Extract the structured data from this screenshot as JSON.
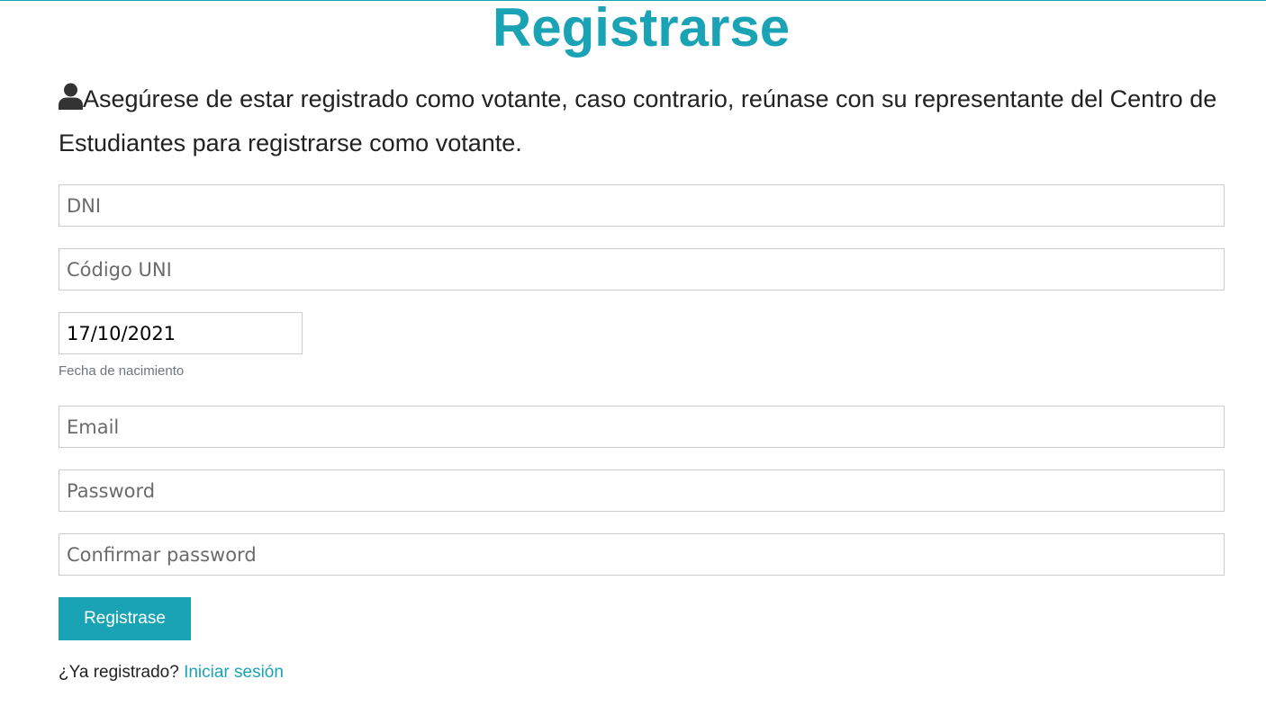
{
  "page": {
    "title": "Registrarse"
  },
  "notice": {
    "icon": "user-icon",
    "text": "Asegúrese de estar registrado como votante, caso contrario, reúnase con su representante del Centro de Estudiantes para registrarse como votante."
  },
  "form": {
    "dni": {
      "placeholder": "DNI",
      "value": ""
    },
    "codigo": {
      "placeholder": "Código UNI",
      "value": ""
    },
    "birthdate": {
      "value": "17/10/2021",
      "help": "Fecha de nacimiento"
    },
    "email": {
      "placeholder": "Email",
      "value": ""
    },
    "password": {
      "placeholder": "Password",
      "value": ""
    },
    "confirm": {
      "placeholder": "Confirmar password",
      "value": ""
    },
    "submit_label": "Registrase"
  },
  "footer": {
    "prompt": "¿Ya registrado?",
    "link_label": "Iniciar sesión"
  },
  "colors": {
    "accent": "#1aa3b5",
    "text": "#222222",
    "border": "#cccccc"
  }
}
